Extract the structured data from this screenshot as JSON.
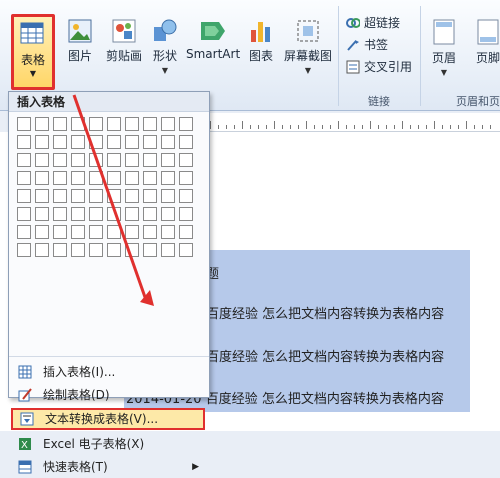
{
  "ribbon": {
    "table_button": {
      "label": "表格",
      "icon": "table-icon"
    },
    "buttons": [
      {
        "id": "picture",
        "label": "图片",
        "icon": "picture-icon"
      },
      {
        "id": "clipart",
        "label": "剪贴画",
        "icon": "clipart-icon"
      },
      {
        "id": "shapes",
        "label": "形状",
        "icon": "shapes-icon"
      },
      {
        "id": "smartart",
        "label": "SmartArt",
        "icon": "smartart-icon"
      },
      {
        "id": "chart",
        "label": "图表",
        "icon": "chart-icon"
      },
      {
        "id": "screenshot",
        "label": "屏幕截图",
        "icon": "screenshot-icon"
      }
    ],
    "links": [
      {
        "id": "hyperlink",
        "label": "超链接",
        "icon": "hyperlink-icon"
      },
      {
        "id": "bookmark",
        "label": "书签",
        "icon": "bookmark-icon"
      },
      {
        "id": "crossref",
        "label": "交叉引用",
        "icon": "cross-reference-icon"
      }
    ],
    "links_group_label": "链接",
    "header_button": "页眉",
    "footer_button": "页脚",
    "header_footer_group_label": "页眉和页"
  },
  "menu": {
    "title": "插入表格",
    "grid": {
      "cols": 10,
      "rows": 8
    },
    "items": [
      {
        "label": "插入表格(I)...",
        "icon": "insert-table-icon",
        "highlighted": false,
        "submenu": false
      },
      {
        "label": "绘制表格(D)",
        "icon": "draw-table-icon",
        "highlighted": false,
        "submenu": false
      },
      {
        "label": "文本转换成表格(V)...",
        "icon": "text-to-table-icon",
        "highlighted": true,
        "submenu": false
      },
      {
        "label": "Excel 电子表格(X)",
        "icon": "excel-icon",
        "highlighted": false,
        "submenu": false
      },
      {
        "label": "快速表格(T)",
        "icon": "quick-table-icon",
        "highlighted": false,
        "submenu": true
      }
    ]
  },
  "document": {
    "lines": [
      "题",
      "百度经验  怎么把文档内容转换为表格内容",
      "百度经验  怎么把文档内容转换为表格内容",
      "2014-01-20 百度经验  怎么把文档内容转换为表格内容"
    ]
  },
  "colors": {
    "highlight_border": "#e0302e",
    "selection": "#b6c9ea",
    "menu_highlight": "#fde9a8"
  }
}
